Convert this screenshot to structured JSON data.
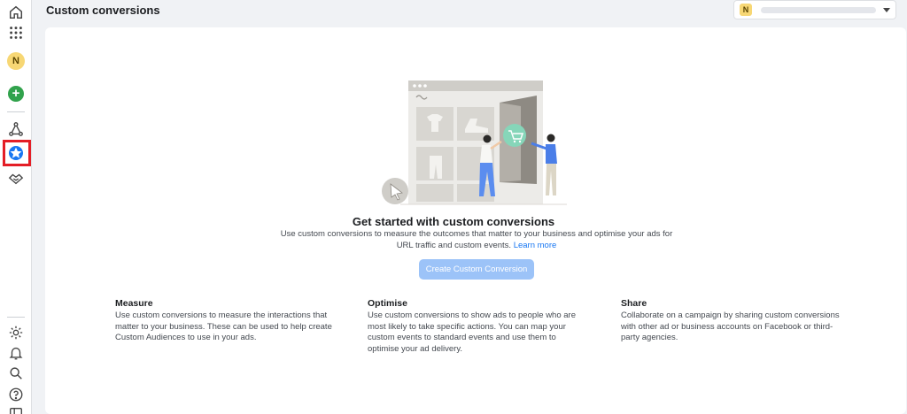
{
  "header": {
    "title": "Custom conversions",
    "account_initial": "N"
  },
  "rail": {
    "avatar_initial": "N",
    "plus_glyph": "+"
  },
  "empty_state": {
    "headline": "Get started with custom conversions",
    "description": "Use custom conversions to measure the outcomes that matter to your business and optimise your ads for URL traffic and custom events.",
    "learn_more": "Learn more",
    "cta_label": "Create Custom Conversion"
  },
  "features": [
    {
      "title": "Measure",
      "body": "Use custom conversions to measure the interactions that matter to your business. These can be used to help create Custom Audiences to use in your ads."
    },
    {
      "title": "Optimise",
      "body": "Use custom conversions to show ads to people who are most likely to take specific actions. You can map your custom events to standard events and use them to optimise your ad delivery."
    },
    {
      "title": "Share",
      "body": "Collaborate on a campaign by sharing custom conversions with other ad or business accounts on Facebook or third-party agencies."
    }
  ],
  "colors": {
    "accent": "#1877f2",
    "disabled_button": "#9cc3f8",
    "highlight": "#e41e26",
    "create_green": "#31a24c"
  }
}
